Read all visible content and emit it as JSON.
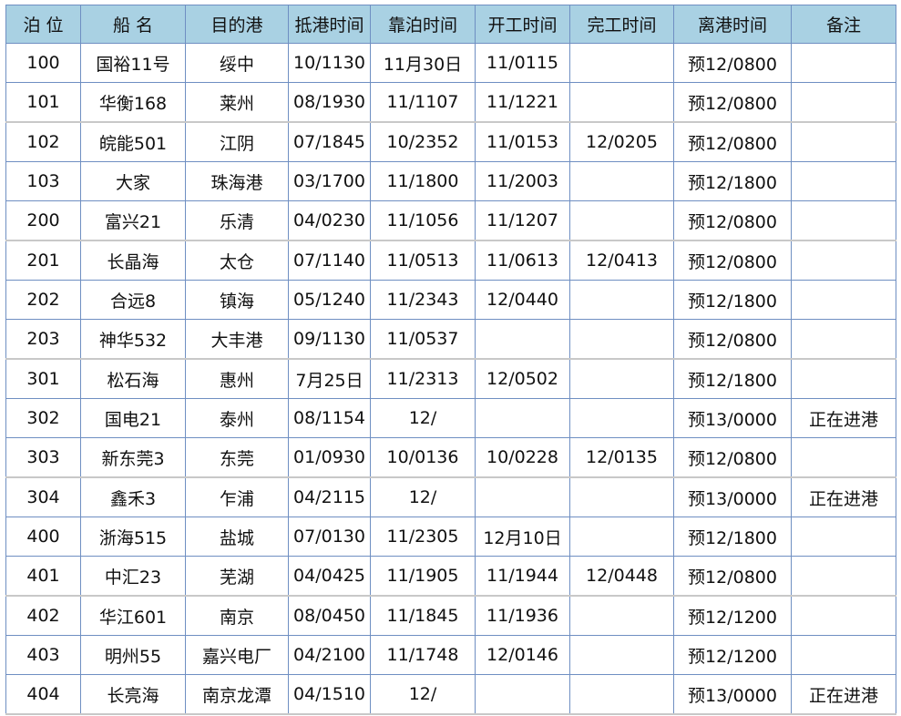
{
  "table": {
    "headers": [
      "泊 位",
      "船 名",
      "目的港",
      "抵港时间",
      "靠泊时间",
      "开工时间",
      "完工时间",
      "离港时间",
      "备注"
    ],
    "rows": [
      [
        "100",
        "国裕11号",
        "绥中",
        "10/1130",
        "11月30日",
        "11/0115",
        "",
        "预12/0800",
        ""
      ],
      [
        "101",
        "华衡168",
        "莱州",
        "08/1930",
        "11/1107",
        "11/1221",
        "",
        "预12/0800",
        ""
      ],
      [
        "102",
        "皖能501",
        "江阴",
        "07/1845",
        "10/2352",
        "11/0153",
        "12/0205",
        "预12/0800",
        ""
      ],
      [
        "103",
        "大家",
        "珠海港",
        "03/1700",
        "11/1800",
        "11/2003",
        "",
        "预12/1800",
        ""
      ],
      [
        "200",
        "富兴21",
        "乐清",
        "04/0230",
        "11/1056",
        "11/1207",
        "",
        "预12/0800",
        ""
      ],
      [
        "201",
        "长晶海",
        "太仓",
        "07/1140",
        "11/0513",
        "11/0613",
        "12/0413",
        "预12/0800",
        ""
      ],
      [
        "202",
        "合远8",
        "镇海",
        "05/1240",
        "11/2343",
        "12/0440",
        "",
        "预12/1800",
        ""
      ],
      [
        "203",
        "神华532",
        "大丰港",
        "09/1130",
        "11/0537",
        "",
        "",
        "预12/0800",
        ""
      ],
      [
        "301",
        "松石海",
        "惠州",
        "7月25日",
        "11/2313",
        "12/0502",
        "",
        "预12/1800",
        ""
      ],
      [
        "302",
        "国电21",
        "泰州",
        "08/1154",
        "12/",
        "",
        "",
        "预13/0000",
        "正在进港"
      ],
      [
        "303",
        "新东莞3",
        "东莞",
        "01/0930",
        "10/0136",
        "10/0228",
        "12/0135",
        "预12/0800",
        ""
      ],
      [
        "304",
        "鑫禾3",
        "乍浦",
        "04/2115",
        "12/",
        "",
        "",
        "预13/0000",
        "正在进港"
      ],
      [
        "400",
        "浙海515",
        "盐城",
        "07/0130",
        "11/2305",
        "12月10日",
        "",
        "预12/1800",
        ""
      ],
      [
        "401",
        "中汇23",
        "芜湖",
        "04/0425",
        "11/1905",
        "11/1944",
        "12/0448",
        "预12/0800",
        ""
      ],
      [
        "402",
        "华江601",
        "南京",
        "08/0450",
        "11/1845",
        "11/1936",
        "",
        "预12/1200",
        ""
      ],
      [
        "403",
        "明州55",
        "嘉兴电厂",
        "04/2100",
        "11/1748",
        "12/0146",
        "",
        "预12/1200",
        ""
      ],
      [
        "404",
        "长亮海",
        "南京龙潭",
        "04/1510",
        "12/",
        "",
        "",
        "预13/0000",
        "正在进港"
      ]
    ],
    "group_breaks": [
      2,
      5,
      8,
      11,
      14
    ],
    "colors": {
      "header_bg": "#a9d1e3",
      "border": "#6f8fc2",
      "group_separator": "#c8c8c8"
    }
  }
}
